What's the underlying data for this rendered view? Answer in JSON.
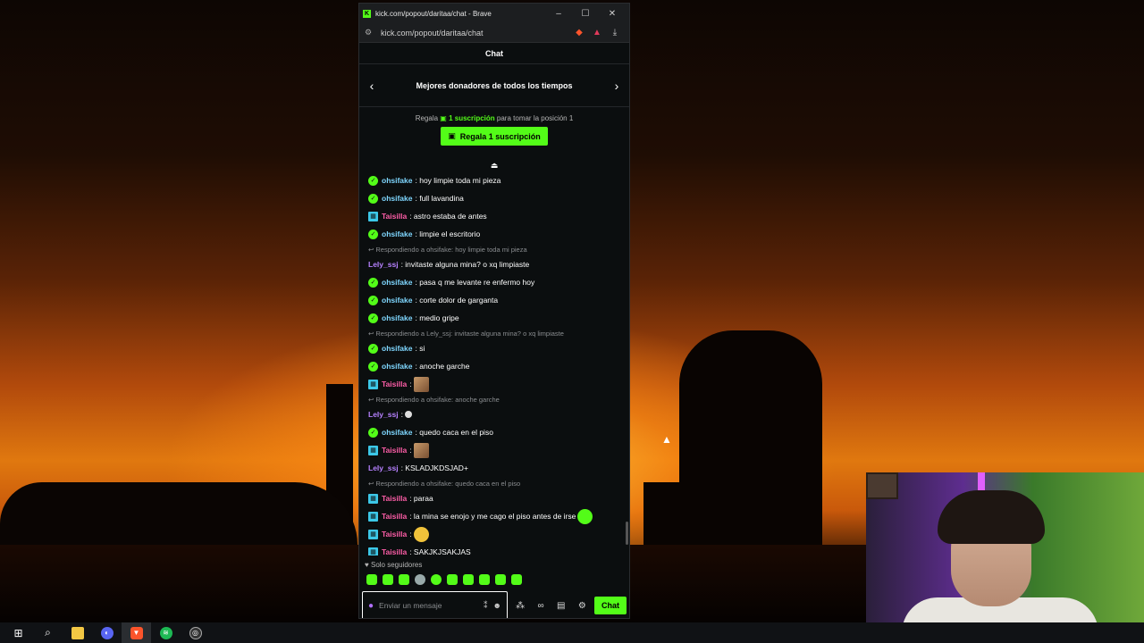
{
  "window": {
    "title": "kick.com/popout/daritaa/chat - Brave",
    "url": "kick.com/popout/daritaa/chat",
    "controls": {
      "minimize": "–",
      "maximize": "☐",
      "close": "✕"
    }
  },
  "chat": {
    "header": "Chat",
    "donors_title": "Mejores donadores de todos los tiempos",
    "gift_prefix": "Regala",
    "gift_highlight": "1 suscripción",
    "gift_suffix": "para tomar la posición 1",
    "gift_button": "Regala 1 suscripción",
    "messages": [
      {
        "user": "ohsifake",
        "text": ": hoy limpie toda mi pieza"
      },
      {
        "user": "ohsifake",
        "text": ": full lavandina"
      },
      {
        "user": "Taisilla",
        "text": ": astro estaba de antes"
      },
      {
        "user": "ohsifake",
        "text": ": limpie el escritorio"
      },
      {
        "reply": "Respondiendo a ohsifake: hoy limpie toda mi pieza",
        "user": "Lely_ssj",
        "text": ": invitaste alguna mina? o xq limpiaste"
      },
      {
        "user": "ohsifake",
        "text": ": pasa q me levante re enfermo hoy"
      },
      {
        "user": "ohsifake",
        "text": ": corte dolor de garganta"
      },
      {
        "user": "ohsifake",
        "text": ": medio gripe"
      },
      {
        "reply": "Respondiendo a Lely_ssj: invitaste alguna mina? o xq limpiaste",
        "user": "ohsifake",
        "text": ": si"
      },
      {
        "user": "ohsifake",
        "text": ": anoche garche"
      },
      {
        "user": "Taisilla",
        "text": ":"
      },
      {
        "reply": "Respondiendo a ohsifake: anoche garche",
        "user": "Lely_ssj",
        "text": ":"
      },
      {
        "user": "ohsifake",
        "text": ": quedo caca en el piso"
      },
      {
        "user": "Taisilla",
        "text": ":"
      },
      {
        "user": "Lely_ssj",
        "text": ": KSLADJKDSJAD+"
      },
      {
        "reply": "Respondiendo a ohsifake: quedo caca en el piso",
        "user": "Taisilla",
        "text": ": paraa"
      },
      {
        "user": "Taisilla",
        "text": ": la mina se enojo y me cago el piso antes de irse"
      },
      {
        "user": "Taisilla",
        "text": ":"
      },
      {
        "user": "Taisilla",
        "text": ": SAKJKJSAKJAS"
      }
    ],
    "followers_only": "Solo seguidores",
    "input_placeholder": "Enviar un mensaje",
    "send_button": "Chat"
  }
}
